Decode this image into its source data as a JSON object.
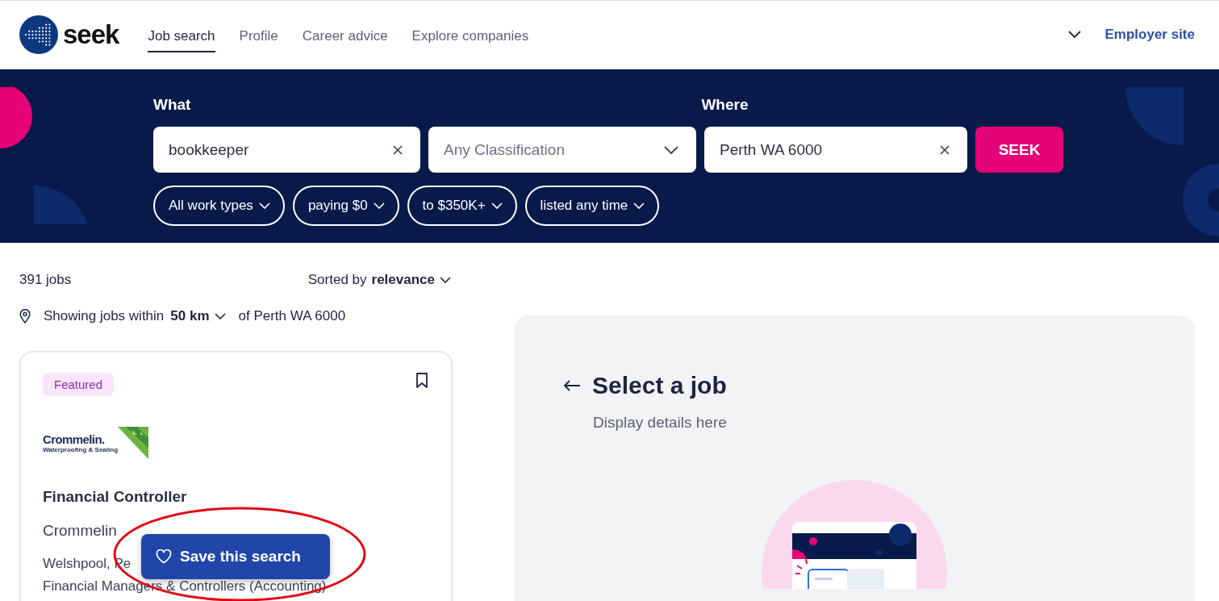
{
  "header": {
    "brand": "seek",
    "nav": [
      {
        "label": "Job search",
        "selected": true
      },
      {
        "label": "Profile",
        "selected": false
      },
      {
        "label": "Career advice",
        "selected": false
      },
      {
        "label": "Explore companies",
        "selected": false
      }
    ],
    "employer_link": "Employer site"
  },
  "search": {
    "what_label": "What",
    "what_value": "bookkeeper",
    "classification_placeholder": "Any Classification",
    "where_label": "Where",
    "where_value": "Perth WA 6000",
    "button": "SEEK",
    "filters": [
      "All work types",
      "paying $0",
      "to $350K+",
      "listed any time"
    ]
  },
  "results": {
    "count": "391 jobs",
    "sort_prefix": "Sorted by",
    "sort_value": "relevance",
    "location_prefix": "Showing jobs within",
    "radius": "50 km",
    "location_suffix": "of Perth WA 6000"
  },
  "job_card": {
    "badge": "Featured",
    "logo_name": "Crommelin.",
    "logo_tagline": "Waterproofing & Sealing",
    "title": "Financial Controller",
    "company": "Crommelin",
    "location": "Welshpool, Pe",
    "classification": "Financial Managers & Controllers  (Accounting)"
  },
  "save_search_button": "Save this search",
  "detail_panel": {
    "title": "Select a job",
    "subtitle": "Display details here"
  }
}
